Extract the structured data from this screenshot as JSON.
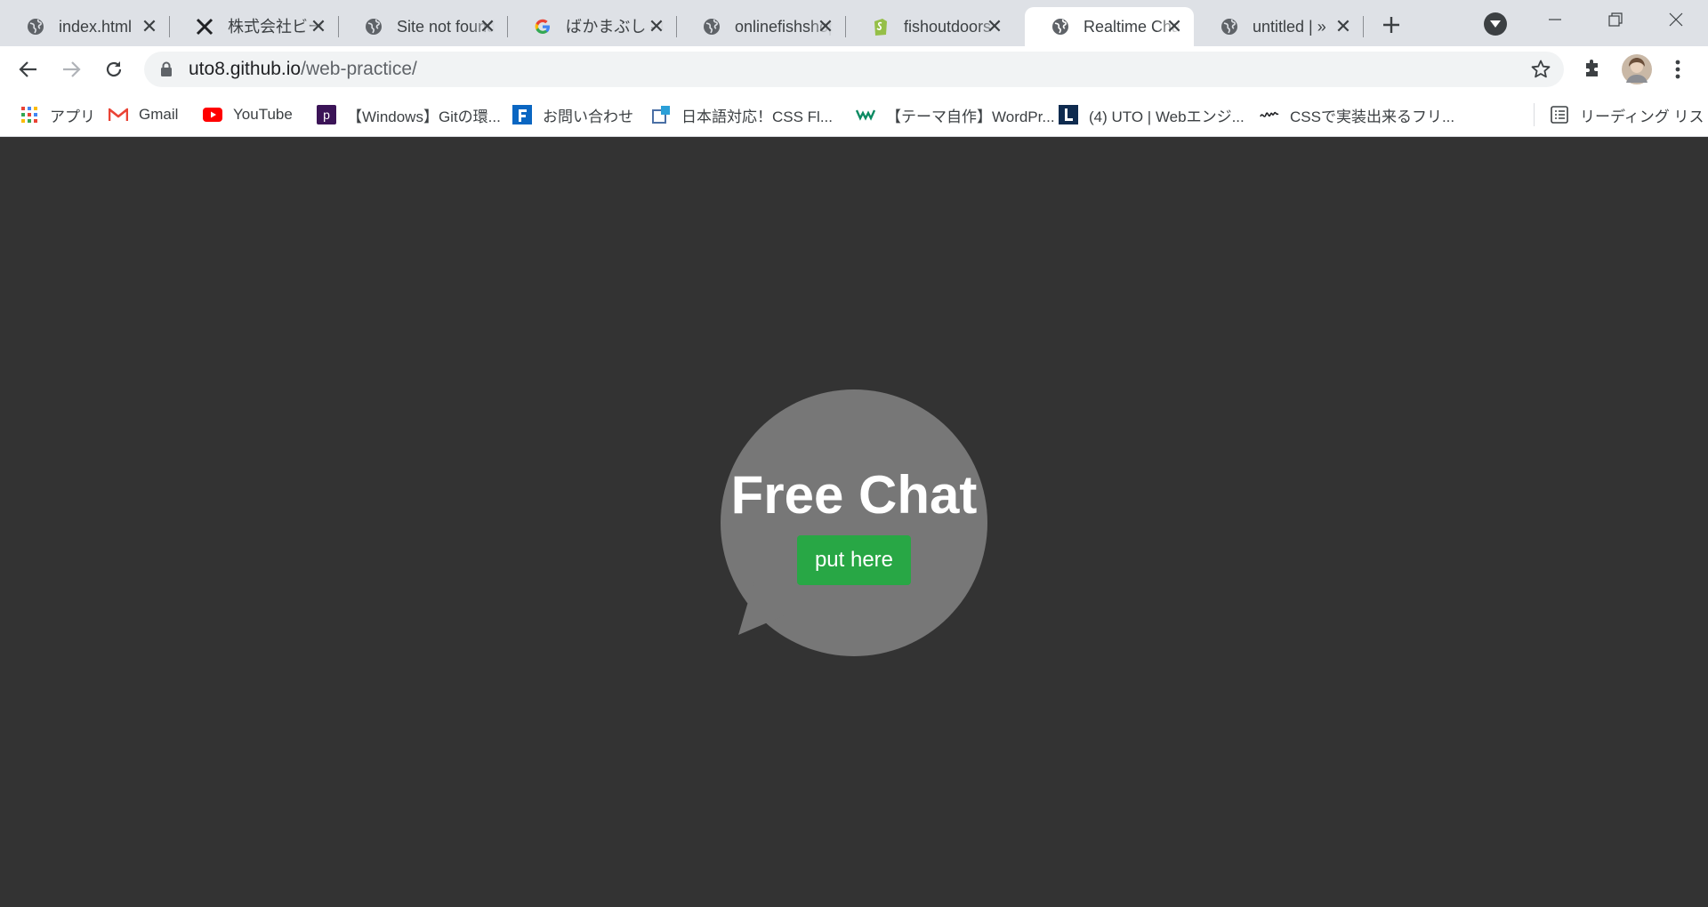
{
  "tabs": [
    {
      "title": "index.html",
      "icon": "globe-icon",
      "active": false
    },
    {
      "title": "株式会社ビーエックス",
      "icon": "x-logo-icon",
      "active": false
    },
    {
      "title": "Site not found",
      "icon": "globe-icon",
      "active": false
    },
    {
      "title": "ばかまぶし - Google",
      "icon": "google-icon",
      "active": false
    },
    {
      "title": "onlinefishshop",
      "icon": "globe-icon",
      "active": false
    },
    {
      "title": "fishoutdoors",
      "icon": "shopify-icon",
      "active": false
    },
    {
      "title": "Realtime Chat",
      "icon": "globe-icon",
      "active": true
    },
    {
      "title": "untitled | »",
      "icon": "globe-icon",
      "active": false
    }
  ],
  "omnibox": {
    "host": "uto8.github.io",
    "path": "/web-practice/"
  },
  "bookmarks": [
    {
      "label": "アプリ",
      "icon": "apps-grid-icon"
    },
    {
      "label": "Gmail",
      "icon": "gmail-icon"
    },
    {
      "label": "YouTube",
      "icon": "youtube-icon"
    },
    {
      "label": "【Windows】Gitの環...",
      "icon": "purple-p-icon"
    },
    {
      "label": "お問い合わせ",
      "icon": "blue-f-icon"
    },
    {
      "label": "日本語対応！CSS Fl...",
      "icon": "external-box-icon"
    },
    {
      "label": "【テーマ自作】WordPr...",
      "icon": "green-logo-icon"
    },
    {
      "label": "(4) UTO | Webエンジ...",
      "icon": "l-logo-icon"
    },
    {
      "label": "CSSで実装出来るフリ...",
      "icon": "handwriting-icon"
    }
  ],
  "reading_list": "リーディング リスト",
  "main": {
    "title": "Free Chat",
    "button_label": "put here"
  },
  "colors": {
    "page_bg": "#333333",
    "bubble": "#777777",
    "button": "#28a745",
    "tab_strip": "#dee1e6"
  }
}
